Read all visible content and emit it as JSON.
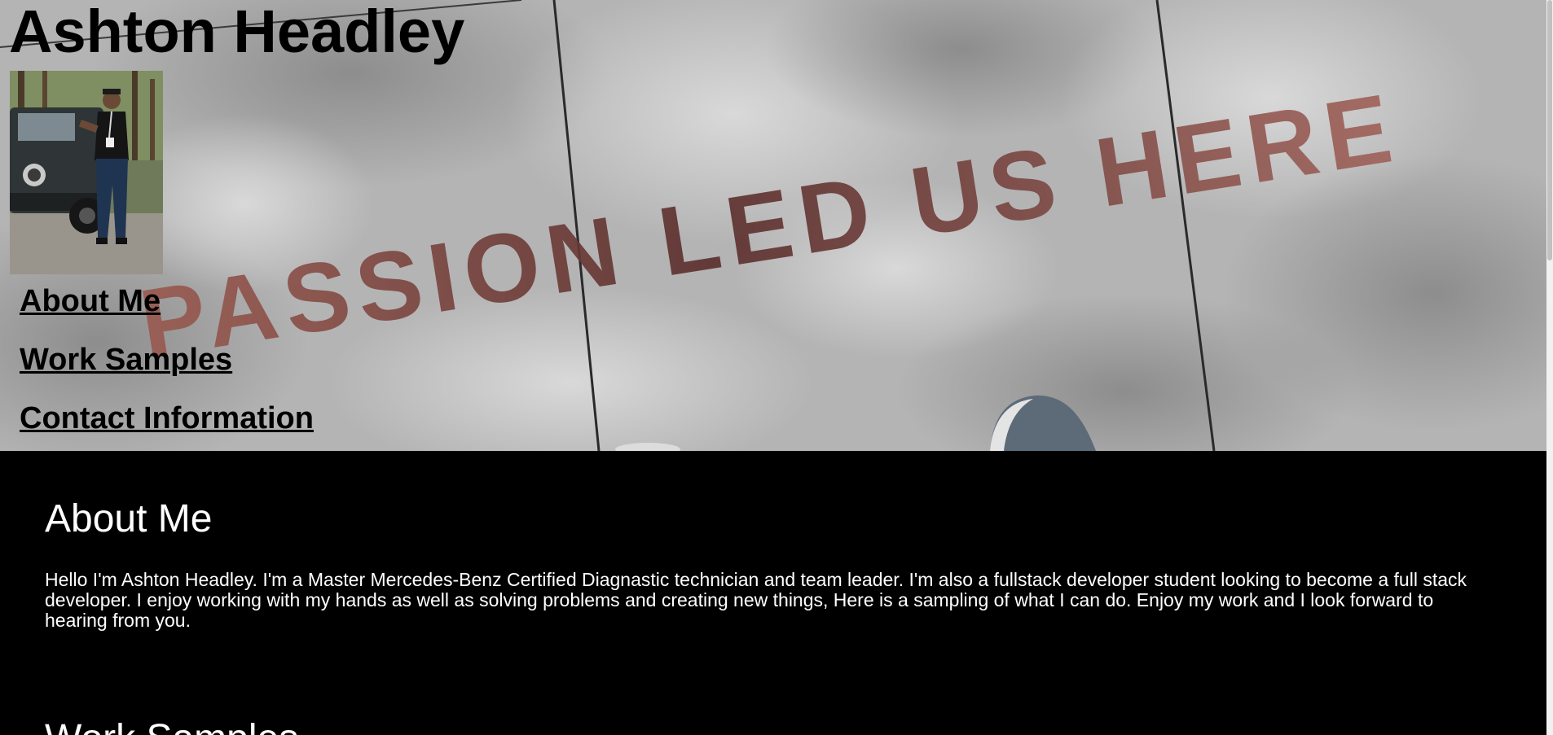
{
  "header": {
    "site_title": "Ashton Headley",
    "background_text": "PASSION LED US HERE",
    "nav_items": [
      {
        "label": "About Me"
      },
      {
        "label": "Work Samples"
      },
      {
        "label": "Contact Information"
      }
    ]
  },
  "about": {
    "heading": "About Me",
    "body": "Hello I'm Ashton Headley. I'm a Master Mercedes-Benz Certified Diagnastic technician and team leader. I'm also a fullstack developer student looking to become a full stack developer. I enjoy working with my hands as well as solving problems and creating new things, Here is a sampling of what I can do. Enjoy my work and I look forward to hearing from you."
  },
  "work": {
    "heading": "Work Samples"
  },
  "colors": {
    "content_background": "#000000",
    "content_text": "#ffffff",
    "header_text": "#000000",
    "sidewalk_letters": "#7a3f3a"
  }
}
